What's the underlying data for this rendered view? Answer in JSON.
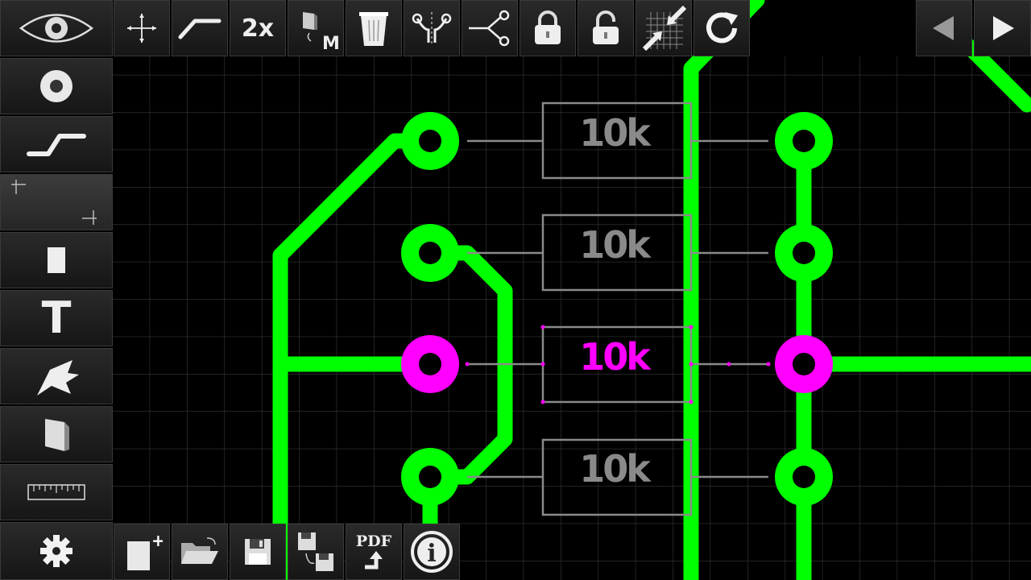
{
  "colors": {
    "copper": "#00ff00",
    "selected": "#ff00ff",
    "silk": "#8a8a8a",
    "grid": "#3a3a3a"
  },
  "top_toolbar": {
    "buttons": [
      {
        "name": "move-button",
        "icon": "move-crosshair-icon"
      },
      {
        "name": "track-tool-button",
        "icon": "track-icon"
      },
      {
        "name": "zoom-2x-button",
        "label": "2x"
      },
      {
        "name": "mirror-button",
        "icon": "mirror-m-icon",
        "label": "M"
      },
      {
        "name": "delete-button",
        "icon": "trash-icon"
      },
      {
        "name": "split-track-button",
        "icon": "split-icon"
      },
      {
        "name": "branch-button",
        "icon": "branch-icon"
      },
      {
        "name": "lock-button",
        "icon": "lock-icon"
      },
      {
        "name": "unlock-button",
        "icon": "unlock-icon"
      },
      {
        "name": "snap-grid-button",
        "icon": "snap-grid-icon"
      },
      {
        "name": "refresh-button",
        "icon": "refresh-icon"
      }
    ],
    "nav": [
      "prev-arrow-icon",
      "next-arrow-icon"
    ]
  },
  "left_toolbar": [
    {
      "name": "view-button",
      "icon": "eye-icon"
    },
    {
      "name": "pad-tool-button",
      "icon": "pad-icon"
    },
    {
      "name": "track-draw-button",
      "icon": "track-icon"
    },
    {
      "name": "area-select-button",
      "icon": "corner-marks-icon",
      "active": true
    },
    {
      "name": "smd-pad-button",
      "icon": "smd-icon"
    },
    {
      "name": "text-tool-button",
      "label": "T"
    },
    {
      "name": "zone-tool-button",
      "icon": "zone-icon"
    },
    {
      "name": "component-button",
      "icon": "component-icon"
    },
    {
      "name": "measure-button",
      "icon": "ruler-icon"
    },
    {
      "name": "settings-button",
      "icon": "gear-icon"
    }
  ],
  "bottom_toolbar": [
    {
      "name": "new-file-button",
      "icon": "new-file-icon",
      "label": "+"
    },
    {
      "name": "open-file-button",
      "icon": "folder-open-icon"
    },
    {
      "name": "save-button",
      "icon": "save-icon"
    },
    {
      "name": "save-as-button",
      "icon": "save-as-icon"
    },
    {
      "name": "export-pdf-button",
      "label": "PDF"
    },
    {
      "name": "info-button",
      "icon": "info-icon",
      "label": "i"
    }
  ],
  "board": {
    "resistors": [
      {
        "value": "10k",
        "selected": false
      },
      {
        "value": "10k",
        "selected": false
      },
      {
        "value": "10k",
        "selected": true
      },
      {
        "value": "10k",
        "selected": false
      }
    ]
  }
}
